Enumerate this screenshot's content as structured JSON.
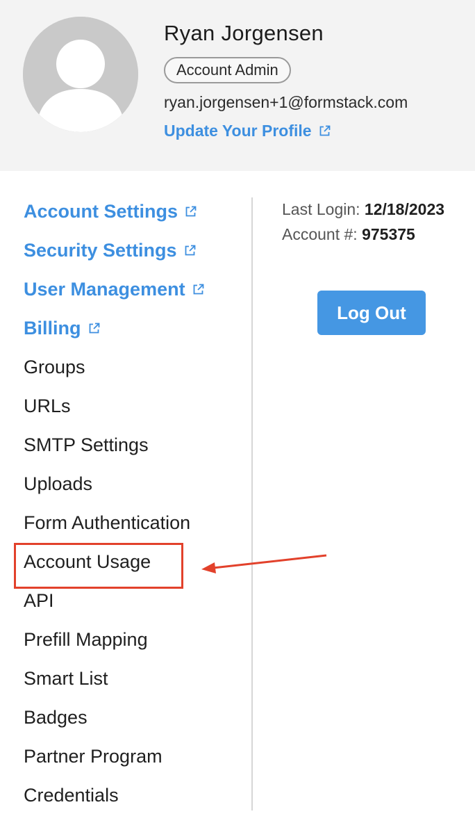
{
  "profile": {
    "name": "Ryan Jorgensen",
    "role": "Account Admin",
    "email": "ryan.jorgensen+1@formstack.com",
    "update_link": "Update Your Profile"
  },
  "nav": {
    "external_items": [
      {
        "label": "Account Settings",
        "icon": "external-link-icon"
      },
      {
        "label": "Security Settings",
        "icon": "external-link-icon"
      },
      {
        "label": "User Management",
        "icon": "external-link-icon"
      },
      {
        "label": "Billing",
        "icon": "external-link-icon"
      }
    ],
    "items": [
      "Groups",
      "URLs",
      "SMTP Settings",
      "Uploads",
      "Form Authentication",
      "Account Usage",
      "API",
      "Prefill Mapping",
      "Smart List",
      "Badges",
      "Partner Program",
      "Credentials"
    ],
    "highlighted_item": "Account Usage"
  },
  "account_meta": {
    "last_login_label": "Last Login:",
    "last_login_value": "12/18/2023",
    "account_number_label": "Account #:",
    "account_number_value": "975375"
  },
  "actions": {
    "logout_label": "Log Out"
  },
  "colors": {
    "link_blue": "#3d8fe0",
    "button_blue": "#4597e3",
    "annotation_red": "#e2412b",
    "header_bg": "#f3f3f3"
  }
}
